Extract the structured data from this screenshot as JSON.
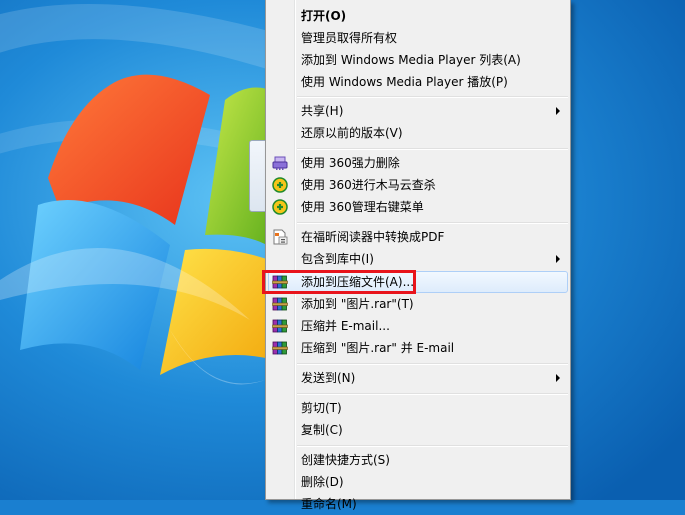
{
  "menu": {
    "items": [
      {
        "label": "打开(O)",
        "bold": true,
        "icon": "none",
        "submenu": false
      },
      {
        "label": "管理员取得所有权",
        "icon": "none",
        "submenu": false
      },
      {
        "label": "添加到 Windows Media Player 列表(A)",
        "icon": "none",
        "submenu": false
      },
      {
        "label": "使用 Windows Media Player 播放(P)",
        "icon": "none",
        "submenu": false
      },
      {
        "label": "共享(H)",
        "icon": "none",
        "submenu": true
      },
      {
        "label": "还原以前的版本(V)",
        "icon": "none",
        "submenu": false
      },
      {
        "label": "使用 360强力删除",
        "icon": "360-shredder-icon",
        "submenu": false
      },
      {
        "label": "使用 360进行木马云查杀",
        "icon": "360-antivirus-icon",
        "submenu": false
      },
      {
        "label": "使用 360管理右键菜单",
        "icon": "360-menu-manager-icon",
        "submenu": false
      },
      {
        "label": "在福昕阅读器中转换成PDF",
        "icon": "foxit-pdf-icon",
        "submenu": false
      },
      {
        "label": "包含到库中(I)",
        "icon": "none",
        "submenu": true
      },
      {
        "label": "添加到压缩文件(A)...",
        "icon": "winrar-icon",
        "submenu": false,
        "hover": true
      },
      {
        "label": "添加到 \"图片.rar\"(T)",
        "icon": "winrar-icon",
        "submenu": false
      },
      {
        "label": "压缩并 E-mail...",
        "icon": "winrar-icon",
        "submenu": false
      },
      {
        "label": "压缩到 \"图片.rar\" 并 E-mail",
        "icon": "winrar-icon",
        "submenu": false
      },
      {
        "label": "发送到(N)",
        "icon": "none",
        "submenu": true
      },
      {
        "label": "剪切(T)",
        "icon": "none",
        "submenu": false
      },
      {
        "label": "复制(C)",
        "icon": "none",
        "submenu": false
      },
      {
        "label": "创建快捷方式(S)",
        "icon": "none",
        "submenu": false
      },
      {
        "label": "删除(D)",
        "icon": "none",
        "submenu": false
      },
      {
        "label": "重命名(M)",
        "icon": "none",
        "submenu": false
      }
    ]
  },
  "colors": {
    "highlight_border": "#e8141c",
    "menu_background": "#f0f0f0",
    "hover_background": "#deecfc",
    "desktop_blue": "#1a7fd0"
  }
}
